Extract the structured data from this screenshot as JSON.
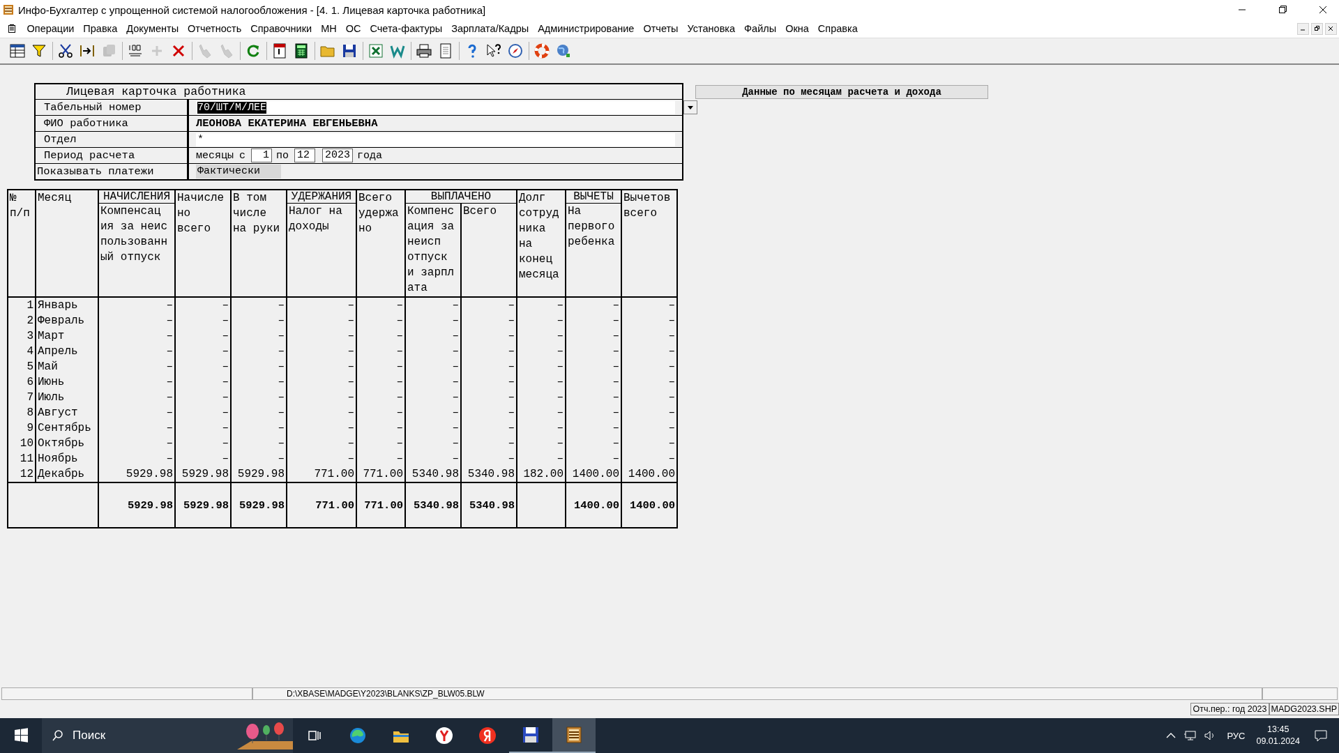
{
  "window": {
    "title": "Инфо-Бухгалтер с упрощенной системой налогообложения - [4. 1. Лицевая карточка работника]"
  },
  "menu": [
    "Операции",
    "Правка",
    "Документы",
    "Отчетность",
    "Справочники",
    "МН",
    "ОС",
    "Счета-фактуры",
    "Зарплата/Кадры",
    "Администрирование",
    "Отчеты",
    "Установка",
    "Файлы",
    "Окна",
    "Справка"
  ],
  "toolbar": [
    {
      "buttons": [
        {
          "kind": "grid",
          "disabled": false
        },
        {
          "kind": "filter",
          "disabled": false
        }
      ]
    },
    {
      "buttons": [
        {
          "kind": "scissors",
          "disabled": false
        },
        {
          "kind": "move",
          "disabled": false
        },
        {
          "kind": "copy",
          "disabled": true
        }
      ]
    },
    {
      "buttons": [
        {
          "kind": "numbering",
          "disabled": false
        },
        {
          "kind": "plus",
          "disabled": true
        },
        {
          "kind": "delete",
          "disabled": false
        }
      ]
    },
    {
      "buttons": [
        {
          "kind": "hand",
          "disabled": true
        },
        {
          "kind": "hand",
          "disabled": true
        }
      ]
    },
    {
      "buttons": [
        {
          "kind": "refresh",
          "disabled": false
        }
      ]
    },
    {
      "buttons": [
        {
          "kind": "calendar",
          "disabled": false
        },
        {
          "kind": "calculator",
          "disabled": false
        }
      ]
    },
    {
      "buttons": [
        {
          "kind": "folder",
          "disabled": false
        },
        {
          "kind": "save",
          "disabled": false
        }
      ]
    },
    {
      "buttons": [
        {
          "kind": "excel",
          "disabled": false
        },
        {
          "kind": "word",
          "disabled": false
        }
      ]
    },
    {
      "buttons": [
        {
          "kind": "printer",
          "disabled": false
        },
        {
          "kind": "page",
          "disabled": false
        }
      ]
    },
    {
      "buttons": [
        {
          "kind": "help",
          "disabled": false
        },
        {
          "kind": "pointer-help",
          "disabled": false
        },
        {
          "kind": "compass",
          "disabled": false
        }
      ]
    },
    {
      "buttons": [
        {
          "kind": "lifebuoy",
          "disabled": false
        },
        {
          "kind": "globe",
          "disabled": false
        }
      ]
    }
  ],
  "card": {
    "title": "Лицевая карточка работника",
    "fields": [
      {
        "kind": "dropdown",
        "label": "Табельный номер",
        "value": "70/ШТ/М/ЛЕЕ"
      },
      {
        "kind": "text",
        "label": "ФИО работника",
        "value": "ЛЕОНОВА ЕКАТЕРИНА ЕВГЕНЬЕВНА"
      },
      {
        "kind": "input",
        "label": "Отдел",
        "value": "*"
      },
      {
        "kind": "period",
        "label": "Период расчета",
        "prefix": "месяцы",
        "from_label": "с",
        "from": "1",
        "to_label": "по",
        "to": "12",
        "year": "2023",
        "suffix": "года"
      },
      {
        "kind": "choice",
        "label": "Показывать платежи",
        "value": "Фактически"
      }
    ]
  },
  "side_button": "Данные по месяцам расчета и дохода",
  "table": {
    "header": [
      {
        "kind": "column",
        "title": "№\nп/п"
      },
      {
        "kind": "column",
        "title": "Месяц"
      },
      {
        "kind": "group",
        "title": "НАЧИСЛЕНИЯ",
        "columns": [
          "Компенсац\nия за неис\nпользованн\nый отпуск"
        ]
      },
      {
        "kind": "column",
        "title": "Начисле\nно\nвсего"
      },
      {
        "kind": "column",
        "title": "В том\nчисле\nна руки"
      },
      {
        "kind": "group",
        "title": "УДЕРЖАНИЯ",
        "columns": [
          "Налог на\nдоходы"
        ]
      },
      {
        "kind": "column",
        "title": "Всего\nудержа\nно"
      },
      {
        "kind": "group",
        "title": "ВЫПЛАЧЕНО",
        "columns": [
          "Компенс\nация за\nнеисп\nотпуск\nи зарпл\nата",
          "Всего"
        ]
      },
      {
        "kind": "column",
        "title": "Долг\nсотруд\nника\nна\nконец\nмесяца"
      },
      {
        "kind": "group",
        "title": "ВЫЧЕТЫ",
        "columns": [
          "На\nпервого\nребенка"
        ]
      },
      {
        "kind": "column",
        "title": "Вычетов\nвсего"
      }
    ],
    "rows": [
      [
        "1",
        "Январь",
        "–",
        "–",
        "–",
        "–",
        "–",
        "–",
        "–",
        "–",
        "–",
        "–"
      ],
      [
        "2",
        "Февраль",
        "–",
        "–",
        "–",
        "–",
        "–",
        "–",
        "–",
        "–",
        "–",
        "–"
      ],
      [
        "3",
        "Март",
        "–",
        "–",
        "–",
        "–",
        "–",
        "–",
        "–",
        "–",
        "–",
        "–"
      ],
      [
        "4",
        "Апрель",
        "–",
        "–",
        "–",
        "–",
        "–",
        "–",
        "–",
        "–",
        "–",
        "–"
      ],
      [
        "5",
        "Май",
        "–",
        "–",
        "–",
        "–",
        "–",
        "–",
        "–",
        "–",
        "–",
        "–"
      ],
      [
        "6",
        "Июнь",
        "–",
        "–",
        "–",
        "–",
        "–",
        "–",
        "–",
        "–",
        "–",
        "–"
      ],
      [
        "7",
        "Июль",
        "–",
        "–",
        "–",
        "–",
        "–",
        "–",
        "–",
        "–",
        "–",
        "–"
      ],
      [
        "8",
        "Август",
        "–",
        "–",
        "–",
        "–",
        "–",
        "–",
        "–",
        "–",
        "–",
        "–"
      ],
      [
        "9",
        "Сентябрь",
        "–",
        "–",
        "–",
        "–",
        "–",
        "–",
        "–",
        "–",
        "–",
        "–"
      ],
      [
        "10",
        "Октябрь",
        "–",
        "–",
        "–",
        "–",
        "–",
        "–",
        "–",
        "–",
        "–",
        "–"
      ],
      [
        "11",
        "Ноябрь",
        "–",
        "–",
        "–",
        "–",
        "–",
        "–",
        "–",
        "–",
        "–",
        "–"
      ],
      [
        "12",
        "Декабрь",
        "5929.98",
        "5929.98",
        "5929.98",
        "771.00",
        "771.00",
        "5340.98",
        "5340.98",
        "182.00",
        "1400.00",
        "1400.00"
      ]
    ],
    "totals": [
      {
        "kind": "value",
        "value": "5929.98"
      },
      {
        "kind": "value",
        "value": "5929.98"
      },
      {
        "kind": "value",
        "value": "5929.98"
      },
      {
        "kind": "value",
        "value": "771.00"
      },
      {
        "kind": "value",
        "value": "771.00"
      },
      {
        "kind": "value",
        "value": "5340.98"
      },
      {
        "kind": "value",
        "value": "5340.98"
      },
      {
        "kind": "blank"
      },
      {
        "kind": "value",
        "value": "1400.00"
      },
      {
        "kind": "value",
        "value": "1400.00"
      }
    ]
  },
  "status_bar": {
    "path": "D:\\XBASE\\MADGE\\Y2023\\BLANKS\\ZP_BLW05.BLW",
    "period": "Отч.пер.: год 2023",
    "file": "MADG2023.SHP"
  },
  "taskbar": {
    "search_placeholder": "Поиск",
    "apps": [
      {
        "kind": "task-view",
        "selected": false,
        "open": false
      },
      {
        "kind": "edge",
        "selected": false,
        "open": false
      },
      {
        "kind": "explorer",
        "selected": false,
        "open": false
      },
      {
        "kind": "yandex-y",
        "selected": false,
        "open": false
      },
      {
        "kind": "yandex-ya",
        "selected": false,
        "open": false
      },
      {
        "kind": "floppy",
        "selected": false,
        "open": true
      },
      {
        "kind": "abacus",
        "selected": true,
        "open": true
      }
    ],
    "language": "РУС",
    "time": "13:45",
    "date": "09.01.2024"
  }
}
